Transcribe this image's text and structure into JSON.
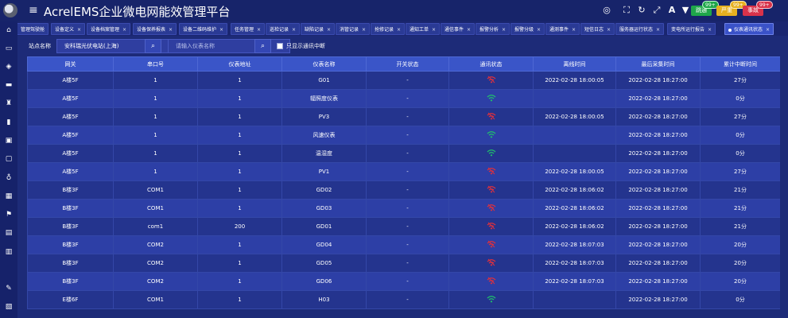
{
  "header": {
    "title": "AcrelEMS企业微电网能效管理平台",
    "icons": [
      "target-icon",
      "expand-icon",
      "refresh-icon",
      "fullscreen-icon",
      "font-icon",
      "shirt-icon"
    ],
    "buttons": [
      {
        "label": "跳通",
        "badge": "99+",
        "color": "#1fa64a"
      },
      {
        "label": "严重",
        "badge": "99+",
        "color": "#e6b020"
      },
      {
        "label": "事故",
        "badge": "99+",
        "color": "#d8324a"
      }
    ]
  },
  "sidebar": {
    "icons": [
      "home-icon",
      "monitor-icon",
      "layers-icon",
      "folder-icon",
      "alarm-icon",
      "chart-icon",
      "window-icon",
      "message-icon",
      "bulb-icon",
      "grid-icon",
      "flag-icon",
      "table-icon",
      "building-icon",
      "edit-icon",
      "doc-icon"
    ]
  },
  "tabs": [
    {
      "label": "管理驾驶舱"
    },
    {
      "label": "设备定义"
    },
    {
      "label": "设备档案管理"
    },
    {
      "label": "设备保养报表"
    },
    {
      "label": "设备二维码维护"
    },
    {
      "label": "任务管理"
    },
    {
      "label": "巡检记录"
    },
    {
      "label": "缺陷记录"
    },
    {
      "label": "消管记录"
    },
    {
      "label": "抢修记录"
    },
    {
      "label": "通知工单"
    },
    {
      "label": "通信事件"
    },
    {
      "label": "报警分析"
    },
    {
      "label": "报警分级"
    },
    {
      "label": "通测事件"
    },
    {
      "label": "短信日志"
    },
    {
      "label": "服务器运行状态"
    },
    {
      "label": "变电所运行报告"
    },
    {
      "label": "仪表通讯状态",
      "active": true
    }
  ],
  "filter": {
    "station_label": "站点名称",
    "station_value": "安科瑞光伏电站(上海)",
    "meter_placeholder": "请输入仪表名称",
    "checkbox_label": "只显示通讯中断"
  },
  "table": {
    "columns": [
      "网关",
      "串口号",
      "仪表地址",
      "仪表名称",
      "开关状态",
      "通讯状态",
      "离线时间",
      "最后采集时间",
      "累计中断时间"
    ],
    "rows": [
      {
        "gateway": "A楼5F",
        "port": "1",
        "address": "1",
        "name": "G01",
        "switch": "-",
        "comm": "offline",
        "offline_time": "2022-02-28 18:00:05",
        "last_time": "2022-02-28 18:27:00",
        "total": "27分"
      },
      {
        "gateway": "A楼5F",
        "port": "1",
        "address": "1",
        "name": "辐照度仪表",
        "switch": "-",
        "comm": "online",
        "offline_time": "",
        "last_time": "2022-02-28 18:27:00",
        "total": "0分"
      },
      {
        "gateway": "A楼5F",
        "port": "1",
        "address": "1",
        "name": "PV3",
        "switch": "-",
        "comm": "offline",
        "offline_time": "2022-02-28 18:00:05",
        "last_time": "2022-02-28 18:27:00",
        "total": "27分"
      },
      {
        "gateway": "A楼5F",
        "port": "1",
        "address": "1",
        "name": "风速仪表",
        "switch": "-",
        "comm": "online",
        "offline_time": "",
        "last_time": "2022-02-28 18:27:00",
        "total": "0分"
      },
      {
        "gateway": "A楼5F",
        "port": "1",
        "address": "1",
        "name": "温湿度",
        "switch": "-",
        "comm": "online",
        "offline_time": "",
        "last_time": "2022-02-28 18:27:00",
        "total": "0分"
      },
      {
        "gateway": "A楼5F",
        "port": "1",
        "address": "1",
        "name": "PV1",
        "switch": "-",
        "comm": "offline",
        "offline_time": "2022-02-28 18:00:05",
        "last_time": "2022-02-28 18:27:00",
        "total": "27分"
      },
      {
        "gateway": "B楼3F",
        "port": "COM1",
        "address": "1",
        "name": "GD02",
        "switch": "-",
        "comm": "offline",
        "offline_time": "2022-02-28 18:06:02",
        "last_time": "2022-02-28 18:27:00",
        "total": "21分"
      },
      {
        "gateway": "B楼3F",
        "port": "COM1",
        "address": "1",
        "name": "GD03",
        "switch": "-",
        "comm": "offline",
        "offline_time": "2022-02-28 18:06:02",
        "last_time": "2022-02-28 18:27:00",
        "total": "21分"
      },
      {
        "gateway": "B楼3F",
        "port": "com1",
        "address": "200",
        "name": "GD01",
        "switch": "-",
        "comm": "offline",
        "offline_time": "2022-02-28 18:06:02",
        "last_time": "2022-02-28 18:27:00",
        "total": "21分"
      },
      {
        "gateway": "B楼3F",
        "port": "COM2",
        "address": "1",
        "name": "GD04",
        "switch": "-",
        "comm": "offline",
        "offline_time": "2022-02-28 18:07:03",
        "last_time": "2022-02-28 18:27:00",
        "total": "20分"
      },
      {
        "gateway": "B楼3F",
        "port": "COM2",
        "address": "1",
        "name": "GD05",
        "switch": "-",
        "comm": "offline",
        "offline_time": "2022-02-28 18:07:03",
        "last_time": "2022-02-28 18:27:00",
        "total": "20分"
      },
      {
        "gateway": "B楼3F",
        "port": "COM2",
        "address": "1",
        "name": "GD06",
        "switch": "-",
        "comm": "offline",
        "offline_time": "2022-02-28 18:07:03",
        "last_time": "2022-02-28 18:27:00",
        "total": "20分"
      },
      {
        "gateway": "E楼6F",
        "port": "COM1",
        "address": "1",
        "name": "H03",
        "switch": "-",
        "comm": "online",
        "offline_time": "",
        "last_time": "2022-02-28 18:27:00",
        "total": "0分"
      }
    ]
  },
  "colors": {
    "online": "#1fc46a",
    "offline": "#e0303c"
  }
}
